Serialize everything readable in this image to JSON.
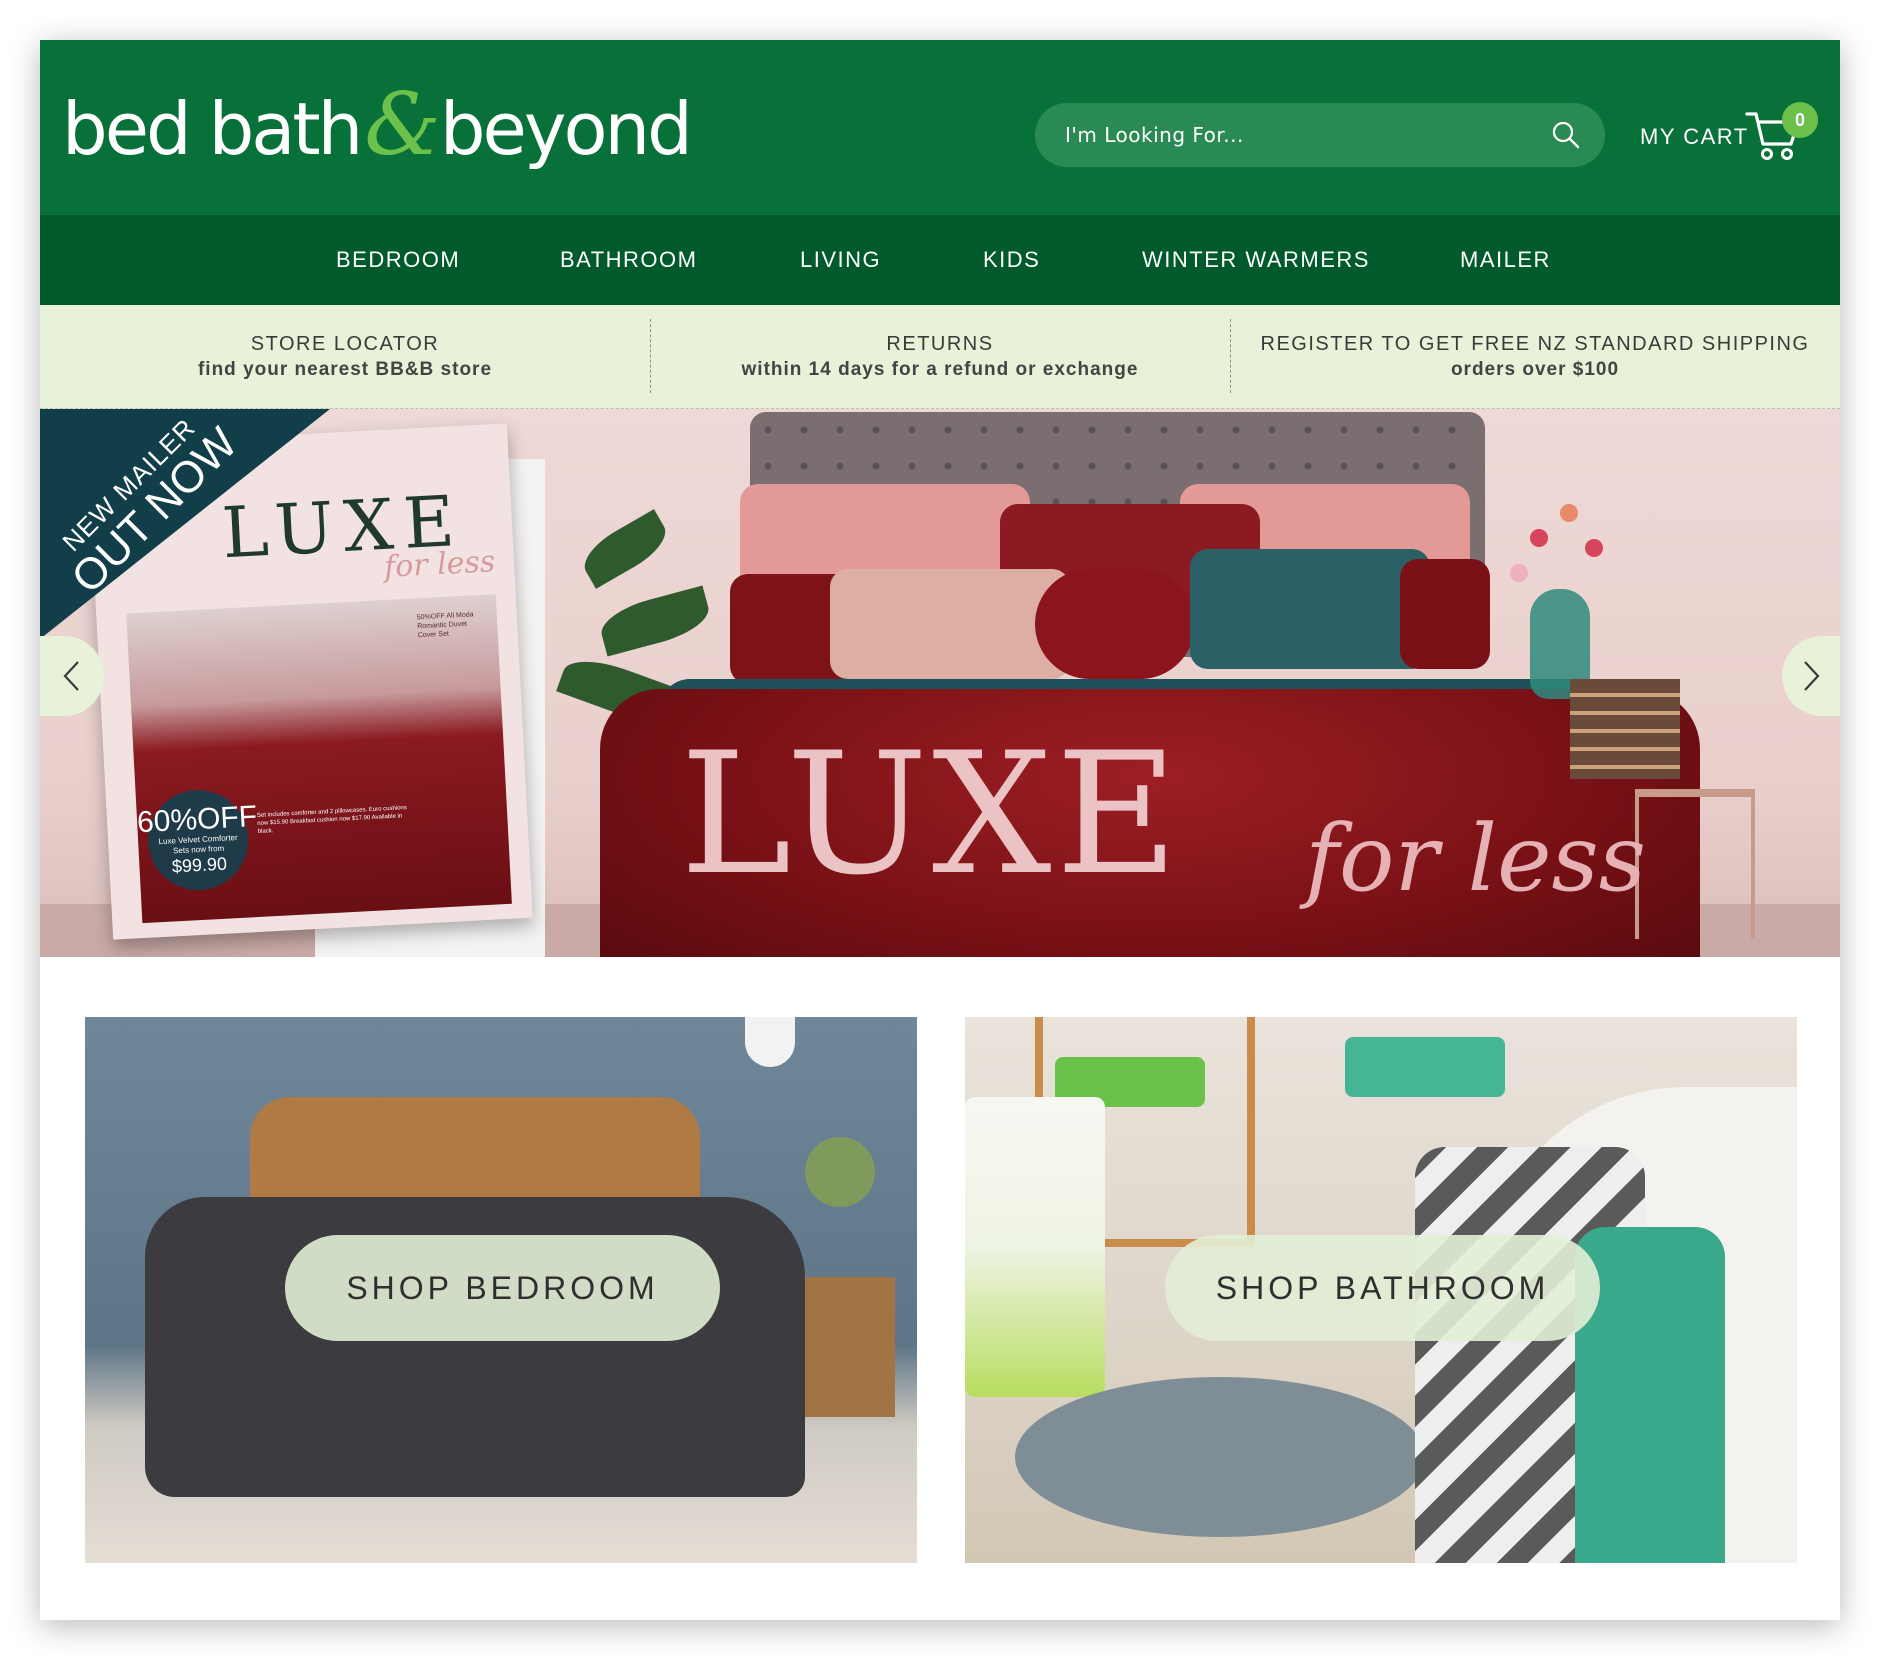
{
  "brand": {
    "logo_word1": "bed bath",
    "logo_amp": "&",
    "logo_word2": "beyond",
    "colors": {
      "header": "#08713a",
      "nav": "#005a2b",
      "accent": "#6cc14b",
      "infobar": "#e8f2d9"
    }
  },
  "search": {
    "placeholder": "I'm Looking For...",
    "icon": "search-icon"
  },
  "cart": {
    "label": "MY CART",
    "count": "0",
    "icon": "cart-icon"
  },
  "nav": {
    "items": [
      {
        "label": "BEDROOM"
      },
      {
        "label": "BATHROOM"
      },
      {
        "label": "LIVING"
      },
      {
        "label": "KIDS"
      },
      {
        "label": "WINTER WARMERS"
      },
      {
        "label": "MAILER"
      }
    ]
  },
  "info": [
    {
      "title": "STORE LOCATOR",
      "sub": "find your nearest BB&B store"
    },
    {
      "title": "RETURNS",
      "sub": "within 14 days for a refund or exchange"
    },
    {
      "title": "REGISTER TO GET FREE NZ STANDARD SHIPPING",
      "sub": "orders over $100"
    }
  ],
  "hero": {
    "ribbon_line1": "NEW MAILER",
    "ribbon_line2": "OUT NOW",
    "title": "LUXE",
    "subtitle": "for less",
    "mailer": {
      "title": "LUXE",
      "subtitle": "for less",
      "note": "50%OFF All Moda Romantic Duvet Cover Set",
      "badge_pct": "60%OFF",
      "badge_desc": "Luxe Velvet Comforter Sets now from",
      "badge_price": "$99.90",
      "fine_print": "Set includes comforter and 2 pillowcases. Euro cushions now $15.90 Breakfast cushion now $17.90 Available in black."
    },
    "prev_icon": "chevron-left-icon",
    "next_icon": "chevron-right-icon"
  },
  "tiles": [
    {
      "label": "SHOP BEDROOM"
    },
    {
      "label": "SHOP BATHROOM"
    }
  ]
}
